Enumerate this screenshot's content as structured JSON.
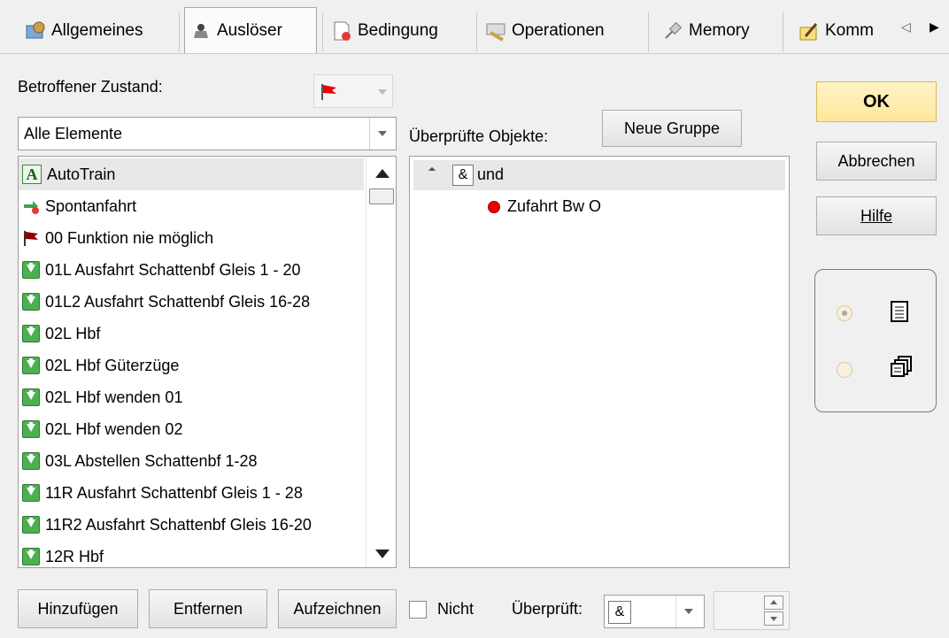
{
  "tabs": [
    {
      "label": "Allgemeines",
      "icon": "gear-icon"
    },
    {
      "label": "Auslöser",
      "icon": "trigger-icon",
      "selected": true
    },
    {
      "label": "Bedingung",
      "icon": "condition-icon"
    },
    {
      "label": "Operationen",
      "icon": "operations-icon"
    },
    {
      "label": "Memory",
      "icon": "pin-icon"
    },
    {
      "label": "Komm",
      "icon": "edit-icon"
    }
  ],
  "left": {
    "state_label": "Betroffener Zustand:",
    "filter_value": "Alle Elemente",
    "items": [
      {
        "label": "AutoTrain",
        "icon": "letter-a-icon"
      },
      {
        "label": "Spontanfahrt",
        "icon": "spontaneous-icon"
      },
      {
        "label": "00 Funktion nie möglich",
        "icon": "flag-icon"
      },
      {
        "label": "01L Ausfahrt Schattenbf Gleis 1 - 20",
        "icon": "green-down-icon"
      },
      {
        "label": "01L2 Ausfahrt Schattenbf Gleis 16-28",
        "icon": "green-down-icon"
      },
      {
        "label": "02L Hbf",
        "icon": "green-down-icon"
      },
      {
        "label": "02L Hbf Güterzüge",
        "icon": "green-down-icon"
      },
      {
        "label": "02L Hbf wenden 01",
        "icon": "green-down-icon"
      },
      {
        "label": "02L Hbf wenden 02",
        "icon": "green-down-icon"
      },
      {
        "label": "03L Abstellen Schattenbf 1-28",
        "icon": "green-down-icon"
      },
      {
        "label": "11R Ausfahrt Schattenbf Gleis 1 - 28",
        "icon": "green-down-icon"
      },
      {
        "label": "11R2 Ausfahrt Schattenbf Gleis 16-20",
        "icon": "green-down-icon"
      },
      {
        "label": "12R Hbf",
        "icon": "green-down-icon"
      }
    ]
  },
  "middle": {
    "checked_label": "Überprüfte Objekte:",
    "new_group": "Neue Gruppe",
    "tree_root": {
      "op": "&",
      "label": "und"
    },
    "tree_child": {
      "label": "Zufahrt Bw O"
    }
  },
  "bottom": {
    "add": "Hinzufügen",
    "remove": "Entfernen",
    "record": "Aufzeichnen",
    "not_label": "Nicht",
    "checked_label": "Überprüft:",
    "checked_value": "&"
  },
  "right": {
    "ok": "OK",
    "cancel": "Abbrechen",
    "help": "Hilfe"
  }
}
